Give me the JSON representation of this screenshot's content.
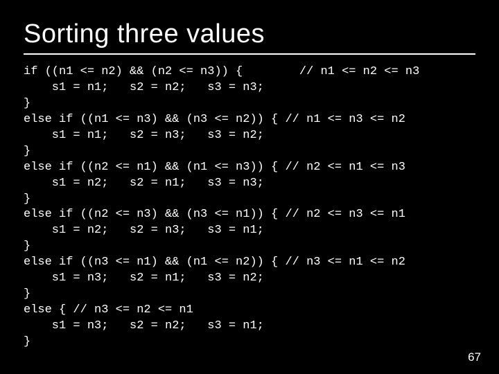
{
  "slide": {
    "title": "Sorting three values",
    "code_lines": [
      "if ((n1 <= n2) && (n2 <= n3)) {        // n1 <= n2 <= n3",
      "    s1 = n1;   s2 = n2;   s3 = n3;",
      "}",
      "else if ((n1 <= n3) && (n3 <= n2)) { // n1 <= n3 <= n2",
      "    s1 = n1;   s2 = n3;   s3 = n2;",
      "}",
      "else if ((n2 <= n1) && (n1 <= n3)) { // n2 <= n1 <= n3",
      "    s1 = n2;   s2 = n1;   s3 = n3;",
      "}",
      "else if ((n2 <= n3) && (n3 <= n1)) { // n2 <= n3 <= n1",
      "    s1 = n2;   s2 = n3;   s3 = n1;",
      "}",
      "else if ((n3 <= n1) && (n1 <= n2)) { // n3 <= n1 <= n2",
      "    s1 = n3;   s2 = n1;   s3 = n2;",
      "}",
      "else { // n3 <= n2 <= n1",
      "    s1 = n3;   s2 = n2;   s3 = n1;",
      "}"
    ],
    "page_number": "67"
  }
}
